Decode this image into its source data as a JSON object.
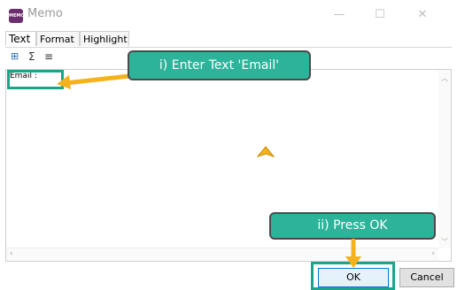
{
  "window": {
    "title": "Memo",
    "app_icon_text": "MEMO",
    "minimize_glyph": "—",
    "maximize_glyph": "☐",
    "close_glyph": "✕"
  },
  "tabs": [
    {
      "label": "Text",
      "active": true
    },
    {
      "label": "Format",
      "active": false
    },
    {
      "label": "Highlight",
      "active": false
    }
  ],
  "toolbar": {
    "icons": [
      "insert-field-icon",
      "sum-icon",
      "align-justify-icon"
    ],
    "sum_glyph": "Σ",
    "align_glyph": "≡",
    "field_glyph": "⊞"
  },
  "editor": {
    "content": "Email :"
  },
  "buttons": {
    "ok": "OK",
    "cancel": "Cancel"
  },
  "annotations": {
    "step1": "i) Enter Text 'Email'",
    "step2": "ii) Press OK",
    "accent": "#2db39a",
    "arrow_color": "#f5b21c"
  }
}
